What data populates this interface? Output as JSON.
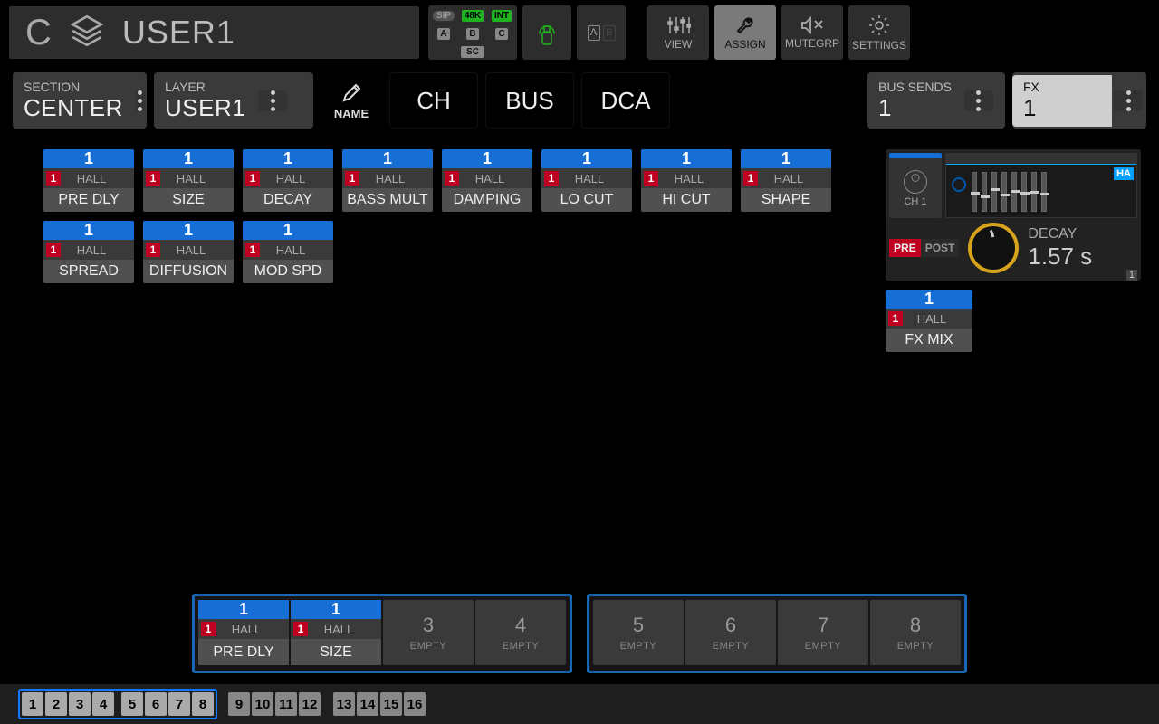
{
  "header": {
    "section_letter": "C",
    "layer_name": "USER1",
    "status": {
      "sip": "SIP",
      "rate": "48K",
      "clock": "INT",
      "a": "A",
      "b": "B",
      "c": "C",
      "sc": "SC"
    },
    "sd": {
      "a": "A",
      "b": "B"
    },
    "nav": {
      "view": "VIEW",
      "assign": "ASSIGN",
      "mutegrp": "MUTEGRP",
      "settings": "SETTINGS"
    }
  },
  "row2": {
    "section": {
      "label": "SECTION",
      "value": "CENTER"
    },
    "layer": {
      "label": "LAYER",
      "value": "USER1"
    },
    "name_btn": "NAME",
    "tabs": {
      "ch": "CH",
      "bus": "BUS",
      "dca": "DCA"
    },
    "bus_sends": {
      "label": "BUS SENDS",
      "value": "1"
    },
    "fx": {
      "label": "FX",
      "value": "1"
    }
  },
  "tiles": [
    {
      "num": "1",
      "badge": "1",
      "sub": "HALL",
      "name": "PRE DLY"
    },
    {
      "num": "1",
      "badge": "1",
      "sub": "HALL",
      "name": "SIZE"
    },
    {
      "num": "1",
      "badge": "1",
      "sub": "HALL",
      "name": "DECAY"
    },
    {
      "num": "1",
      "badge": "1",
      "sub": "HALL",
      "name": "BASS MULT"
    },
    {
      "num": "1",
      "badge": "1",
      "sub": "HALL",
      "name": "DAMPING"
    },
    {
      "num": "1",
      "badge": "1",
      "sub": "HALL",
      "name": "LO CUT"
    },
    {
      "num": "1",
      "badge": "1",
      "sub": "HALL",
      "name": "HI CUT"
    },
    {
      "num": "1",
      "badge": "1",
      "sub": "HALL",
      "name": "SHAPE"
    },
    {
      "num": "1",
      "badge": "1",
      "sub": "HALL",
      "name": "SPREAD"
    },
    {
      "num": "1",
      "badge": "1",
      "sub": "HALL",
      "name": "DIFFUSION"
    },
    {
      "num": "1",
      "badge": "1",
      "sub": "HALL",
      "name": "MOD SPD"
    }
  ],
  "detail": {
    "channel": "CH 1",
    "ha_badge": "HA",
    "prepost": {
      "pre": "PRE",
      "post": "POST"
    },
    "knob": {
      "label": "DECAY",
      "value": "1.57 s"
    },
    "corner": "1"
  },
  "fxmix_tile": {
    "num": "1",
    "badge": "1",
    "sub": "HALL",
    "name": "FX MIX"
  },
  "slots": {
    "groupA": [
      {
        "filled": true,
        "num": "1",
        "badge": "1",
        "sub": "HALL",
        "name": "PRE DLY"
      },
      {
        "filled": true,
        "num": "1",
        "badge": "1",
        "sub": "HALL",
        "name": "SIZE"
      },
      {
        "filled": false,
        "n": "3",
        "e": "EMPTY"
      },
      {
        "filled": false,
        "n": "4",
        "e": "EMPTY"
      }
    ],
    "groupB": [
      {
        "filled": false,
        "n": "5",
        "e": "EMPTY"
      },
      {
        "filled": false,
        "n": "6",
        "e": "EMPTY"
      },
      {
        "filled": false,
        "n": "7",
        "e": "EMPTY"
      },
      {
        "filled": false,
        "n": "8",
        "e": "EMPTY"
      }
    ]
  },
  "pager": {
    "groups": [
      {
        "active": true,
        "pages": [
          "1",
          "2",
          "3",
          "4"
        ]
      },
      {
        "active": true,
        "pages": [
          "5",
          "6",
          "7",
          "8"
        ]
      },
      {
        "active": false,
        "pages": [
          "9",
          "10",
          "11",
          "12"
        ]
      },
      {
        "active": false,
        "pages": [
          "13",
          "14",
          "15",
          "16"
        ]
      }
    ]
  }
}
